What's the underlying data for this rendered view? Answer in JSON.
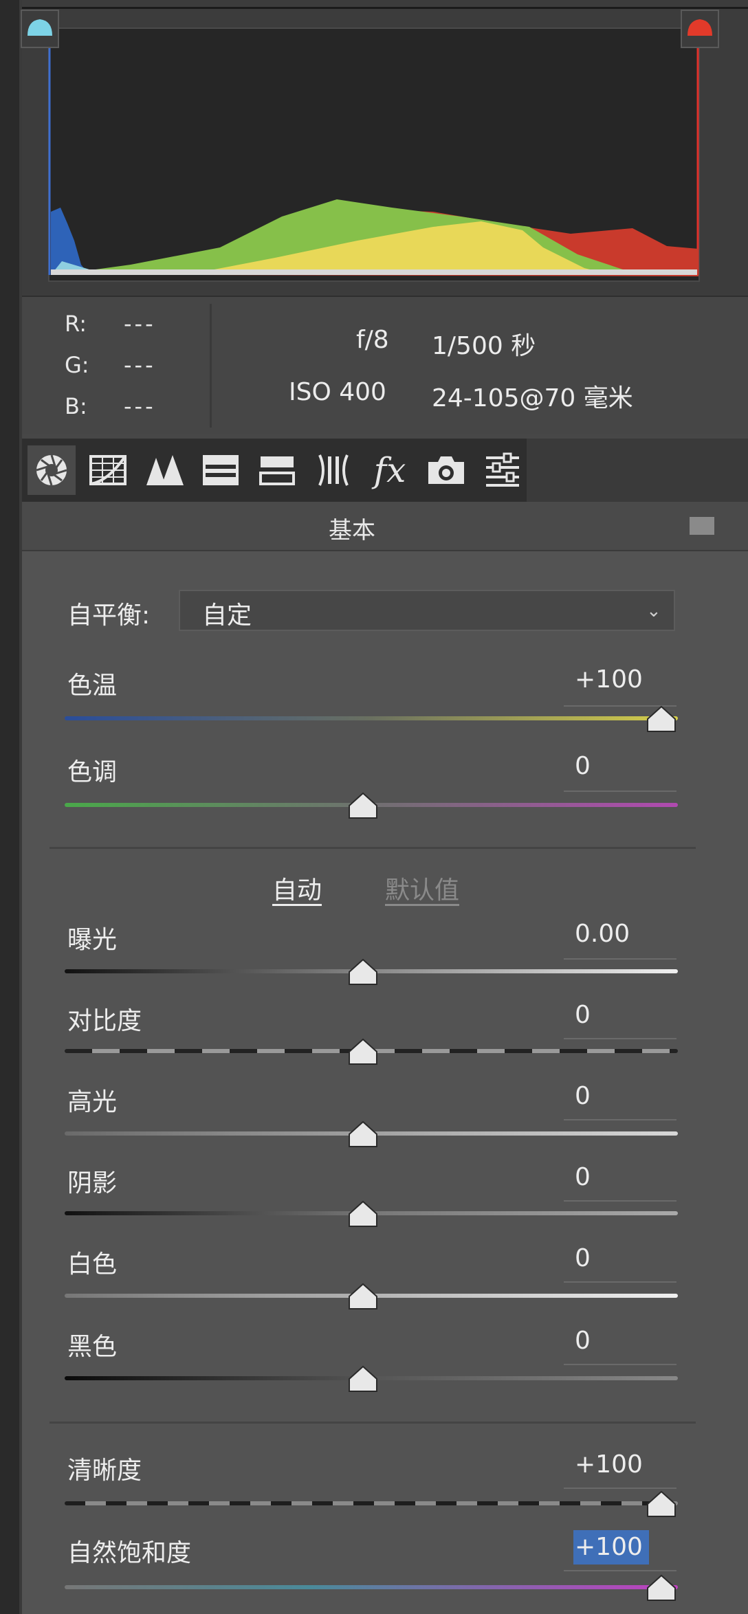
{
  "histogram": {
    "rgb": [
      {
        "label": "R:",
        "value": "---"
      },
      {
        "label": "G:",
        "value": "---"
      },
      {
        "label": "B:",
        "value": "---"
      }
    ],
    "exif": {
      "aperture": "f/8",
      "shutter": "1/500 秒",
      "iso": "ISO 400",
      "lens": "24-105@70 毫米"
    },
    "colors": {
      "shadow_clip": "#7dd3e6",
      "highlight_clip": "#e23a2a"
    }
  },
  "tabs": [
    {
      "name": "basic",
      "icon": "aperture-icon"
    },
    {
      "name": "tone-curve",
      "icon": "tone-curve-icon"
    },
    {
      "name": "detail",
      "icon": "detail-icon"
    },
    {
      "name": "hsl",
      "icon": "hsl-icon"
    },
    {
      "name": "split-toning",
      "icon": "split-toning-icon"
    },
    {
      "name": "lens-corrections",
      "icon": "lens-icon"
    },
    {
      "name": "effects",
      "icon": "fx-icon"
    },
    {
      "name": "camera-calibration",
      "icon": "camera-icon"
    },
    {
      "name": "presets",
      "icon": "sliders-icon"
    }
  ],
  "panel": {
    "title": "基本",
    "white_balance": {
      "label": "自平衡:",
      "value": "自定"
    },
    "temp": {
      "label": "色温",
      "value": "+100",
      "level": 1.0
    },
    "tint": {
      "label": "色调",
      "value": "0",
      "level": 0.5
    },
    "auto_label": "自动",
    "default_label": "默认值",
    "exposure": {
      "label": "曝光",
      "value": "0.00",
      "level": 0.5
    },
    "contrast": {
      "label": "对比度",
      "value": "0",
      "level": 0.5
    },
    "highlights": {
      "label": "高光",
      "value": "0",
      "level": 0.5
    },
    "shadows": {
      "label": "阴影",
      "value": "0",
      "level": 0.5
    },
    "whites": {
      "label": "白色",
      "value": "0",
      "level": 0.5
    },
    "blacks": {
      "label": "黑色",
      "value": "0",
      "level": 0.5
    },
    "clarity": {
      "label": "清晰度",
      "value": "+100",
      "level": 1.0
    },
    "vibrance": {
      "label": "自然饱和度",
      "value": "+100",
      "level": 1.0
    }
  }
}
